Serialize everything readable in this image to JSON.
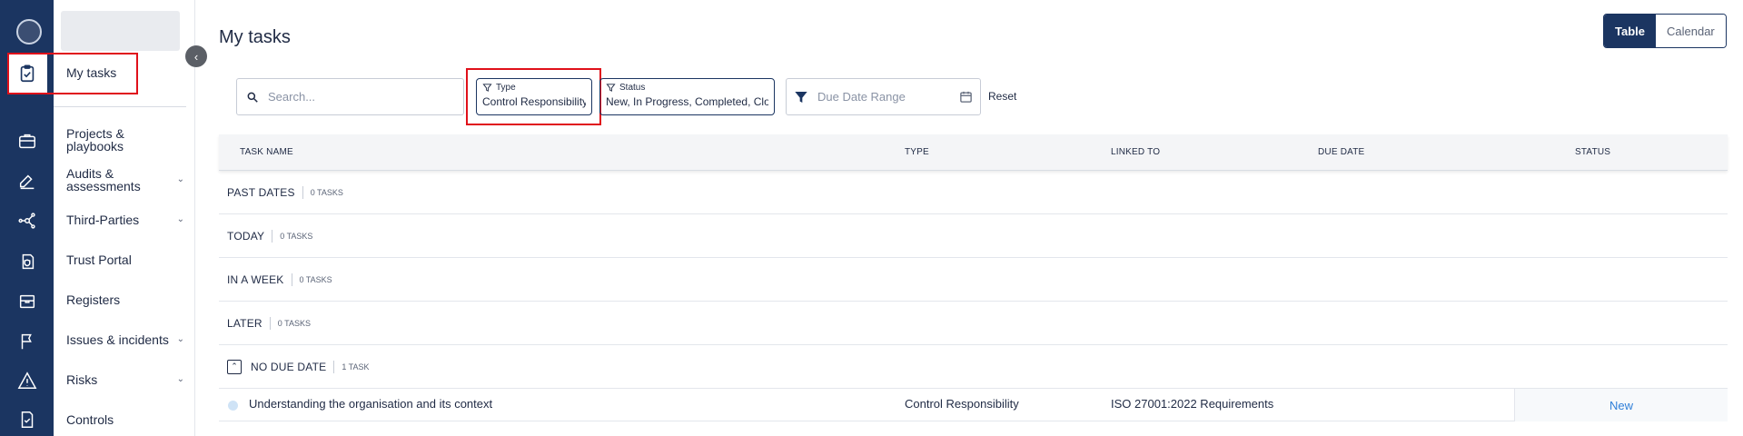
{
  "page": {
    "title": "My tasks"
  },
  "view_toggle": {
    "table": "Table",
    "calendar": "Calendar"
  },
  "sidebar": {
    "items": [
      {
        "label": "My tasks",
        "icon": "clipboard-check-icon"
      },
      {
        "label": "Projects & playbooks",
        "icon": "briefcase-icon"
      },
      {
        "label": "Audits & assessments",
        "icon": "edit-icon",
        "expandable": true
      },
      {
        "label": "Third-Parties",
        "icon": "network-icon",
        "expandable": true
      },
      {
        "label": "Trust Portal",
        "icon": "shield-doc-icon"
      },
      {
        "label": "Registers",
        "icon": "archive-icon"
      },
      {
        "label": "Issues & incidents",
        "icon": "flag-icon",
        "expandable": true
      },
      {
        "label": "Risks",
        "icon": "warning-icon",
        "expandable": true
      },
      {
        "label": "Controls",
        "icon": "doc-check-icon"
      }
    ]
  },
  "filters": {
    "search_placeholder": "Search...",
    "type_label": "Type",
    "type_value": "Control Responsibility",
    "status_label": "Status",
    "status_value": "New, In Progress, Completed, Clo...",
    "date_placeholder": "Due Date Range",
    "reset": "Reset"
  },
  "table": {
    "columns": [
      "TASK NAME",
      "TYPE",
      "LINKED TO",
      "DUE DATE",
      "STATUS"
    ],
    "groups": [
      {
        "name": "PAST DATES",
        "count": "0 TASKS"
      },
      {
        "name": "TODAY",
        "count": "0 TASKS"
      },
      {
        "name": "IN A WEEK",
        "count": "0 TASKS"
      },
      {
        "name": "LATER",
        "count": "0 TASKS"
      },
      {
        "name": "NO DUE DATE",
        "count": "1 TASK"
      }
    ],
    "rows": [
      {
        "task_name": "Understanding the organisation and its context",
        "type": "Control Responsibility",
        "linked_to": "ISO 27001:2022 Requirements",
        "due_date": "",
        "status": "New"
      }
    ]
  },
  "colors": {
    "rail": "#1b3561",
    "highlight": "#e0101a",
    "status_new": "#2f7fd8"
  }
}
